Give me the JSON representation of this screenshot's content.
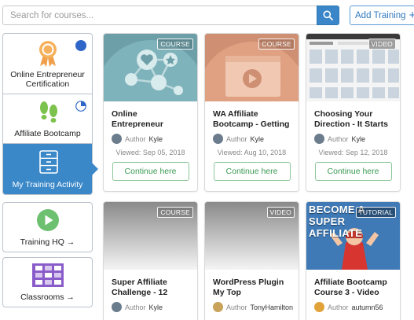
{
  "search": {
    "placeholder": "Search for courses..."
  },
  "header": {
    "add_training_label": "Add Training"
  },
  "sidebar": {
    "items": [
      {
        "label": "Online Entrepreneur Certification",
        "progress_color": "#2f66c8",
        "progress": 1.0
      },
      {
        "label": "Affiliate Bootcamp",
        "progress_color": "#2f66c8",
        "progress": 0.25
      },
      {
        "label": "My Training Activity"
      }
    ],
    "nav": [
      {
        "label": "Training HQ →"
      },
      {
        "label": "Classrooms →"
      }
    ]
  },
  "cards": [
    {
      "badge": "COURSE",
      "title": "Online Entrepreneur Certification -",
      "author_prefix": "Author",
      "author": "Kyle",
      "viewed": "Viewed: Sep 05, 2018",
      "cta": "Continue here"
    },
    {
      "badge": "COURSE",
      "title": "WA Affiliate Bootcamp - Getting",
      "author_prefix": "Author",
      "author": "Kyle",
      "viewed": "Viewed: Aug 10, 2018",
      "cta": "Continue here"
    },
    {
      "badge": "VIDEO",
      "title": "Choosing Your Direction - It Starts",
      "author_prefix": "Author",
      "author": "Kyle",
      "viewed": "Viewed: Sep 12, 2018",
      "cta": "Continue here"
    },
    {
      "badge": "COURSE",
      "title": "Super Affiliate Challenge - 12",
      "author_prefix": "Author",
      "author": "Kyle"
    },
    {
      "badge": "VIDEO",
      "title": "WordPress Plugin My Top",
      "author_prefix": "Author",
      "author": "TonyHamilton"
    },
    {
      "badge": "TUTORIAL",
      "title": "Affiliate Bootcamp Course 3 - Video",
      "author_prefix": "Author",
      "author": "autumn56",
      "thumb_text": "BECOME A SUPER AFFILIATE"
    }
  ],
  "colors": {
    "accent": "#3b88c9",
    "continue_green": "#3a9a52"
  }
}
